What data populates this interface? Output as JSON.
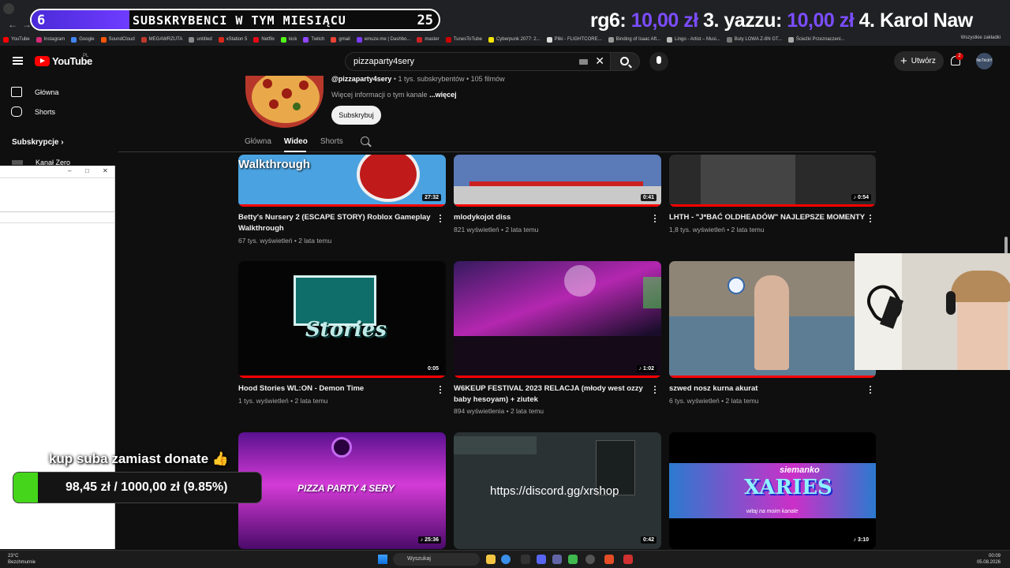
{
  "browser": {
    "bookmarks": [
      {
        "label": "YouTube",
        "color": "#ff0000"
      },
      {
        "label": "Instagram",
        "color": "#d62976"
      },
      {
        "label": "Google",
        "color": "#4285f4"
      },
      {
        "label": "SoundCloud",
        "color": "#ff5500"
      },
      {
        "label": "MEGAWRZUTA",
        "color": "#c0392b"
      },
      {
        "label": "untitled",
        "color": "#888888"
      },
      {
        "label": "xStation 5",
        "color": "#d9281c"
      },
      {
        "label": "Netflix",
        "color": "#e50914"
      },
      {
        "label": "kick",
        "color": "#53fc18"
      },
      {
        "label": "Twitch",
        "color": "#9146ff"
      },
      {
        "label": "gmail",
        "color": "#ea4335"
      },
      {
        "label": "emuze.me | Dashbo...",
        "color": "#7d3cff"
      },
      {
        "label": "master",
        "color": "#cc2222"
      },
      {
        "label": "TunesToTube",
        "color": "#cc0000"
      },
      {
        "label": "Cyberpunk 2077: 2...",
        "color": "#f3e600"
      },
      {
        "label": "Pliki - FLIGHTCORE...",
        "color": "#dddddd"
      },
      {
        "label": "Binding of Isaac Aft...",
        "color": "#999999"
      },
      {
        "label": "Lingo - Artist – Musi...",
        "color": "#bbbbbb"
      },
      {
        "label": "Buty LOWA Z-8N GT...",
        "color": "#777777"
      },
      {
        "label": "Ścieżki Przeznaczeni...",
        "color": "#aaaaaa"
      }
    ],
    "bookmarks_all": "Wszystkie zakładki"
  },
  "overlay": {
    "sub_count": "6",
    "sub_label": "SUBSKRYBENCI W TYM MIESIĄCU",
    "sub_goal": "25",
    "sub_fill": 0.24,
    "ticker_a": "rg6:",
    "ticker_a_amt": "10,00 zł",
    "ticker_b": "3. yazzu:",
    "ticker_b_amt": "10,00 zł",
    "ticker_c": "4. Karol Naw",
    "donate_text": "kup suba zamiast donate 👍",
    "goal_text": "98,45 zł  /  1000,00 zł (9.85%)",
    "goal_fill": 0.0985
  },
  "youtube": {
    "logo": "YouTube",
    "region": "PL",
    "search_value": "pizzaparty4sery",
    "create_label": "Utwórz",
    "notif_count": "2",
    "avatar_text": "NoTrickY"
  },
  "sidebar": {
    "items": [
      {
        "label": "Główna"
      },
      {
        "label": "Shorts"
      }
    ],
    "subs_heading": "Subskrypcje",
    "channel": "Kanał Zero"
  },
  "channel": {
    "handle": "@pizzaparty4sery",
    "stats": " • 1 tys. subskrybentów • 105 filmów",
    "more_info": "Więcej informacji o tym kanale",
    "more_link": "...więcej",
    "subscribe": "Subskrybuj",
    "tabs": [
      "Główna",
      "Wideo",
      "Shorts"
    ]
  },
  "videos": [
    {
      "title1": "Betty's Nursery 2 (ESCAPE STORY) Roblox Gameplay",
      "title2": "Walkthrough",
      "meta": "67 tys. wyświetleń • 2 lata temu",
      "duration": "27:32",
      "thumb_text": "Walkthrough"
    },
    {
      "title1": "mlodykojot diss",
      "title2": "",
      "meta": "821 wyświetleń • 2 lata temu",
      "duration": "0:41"
    },
    {
      "title1": "LHTH - \"J*BAĆ OLDHEADÓW\" NAJLEPSZE MOMENTY",
      "title2": "",
      "meta": "1,8 tys. wyświetleń • 2 lata temu",
      "duration": "♪ 0:54"
    },
    {
      "title1": "Hood Stories WL:ON - Demon Time",
      "title2": "",
      "meta": "1 tys. wyświetleń • 2 lata temu",
      "duration": "0:05",
      "thumb_text": "Stories"
    },
    {
      "title1": "W6KEUP FESTIVAL 2023 RELACJA (młody west ozzy",
      "title2": "baby hesoyam) + ziutek",
      "meta": "894 wyświetlenia • 2 lata temu",
      "duration": "♪ 1:02"
    },
    {
      "title1": "szwed nosz kurna akurat",
      "title2": "",
      "meta": "6 tys. wyświetleń • 2 lata temu",
      "duration": ""
    },
    {
      "title1": "",
      "title2": "",
      "meta": "",
      "duration": "♪ 25:36",
      "thumb_text": "PIZZA PARTY 4 SERY"
    },
    {
      "title1": "",
      "title2": "",
      "meta": "",
      "duration": "0:42",
      "thumb_text": "https://discord.gg/xrshop"
    },
    {
      "title1": "",
      "title2": "",
      "meta": "",
      "duration": "♪ 3:10",
      "thumb_text": "XARIES",
      "thumb_sub": "siemanko",
      "thumb_sub2": "witaj na moim kanale"
    }
  ],
  "taskbar": {
    "temp": "23°C",
    "weather": "Bezchmurnie",
    "search": "Wyszukaj",
    "time": "00:09",
    "date": "05.08.2026"
  }
}
